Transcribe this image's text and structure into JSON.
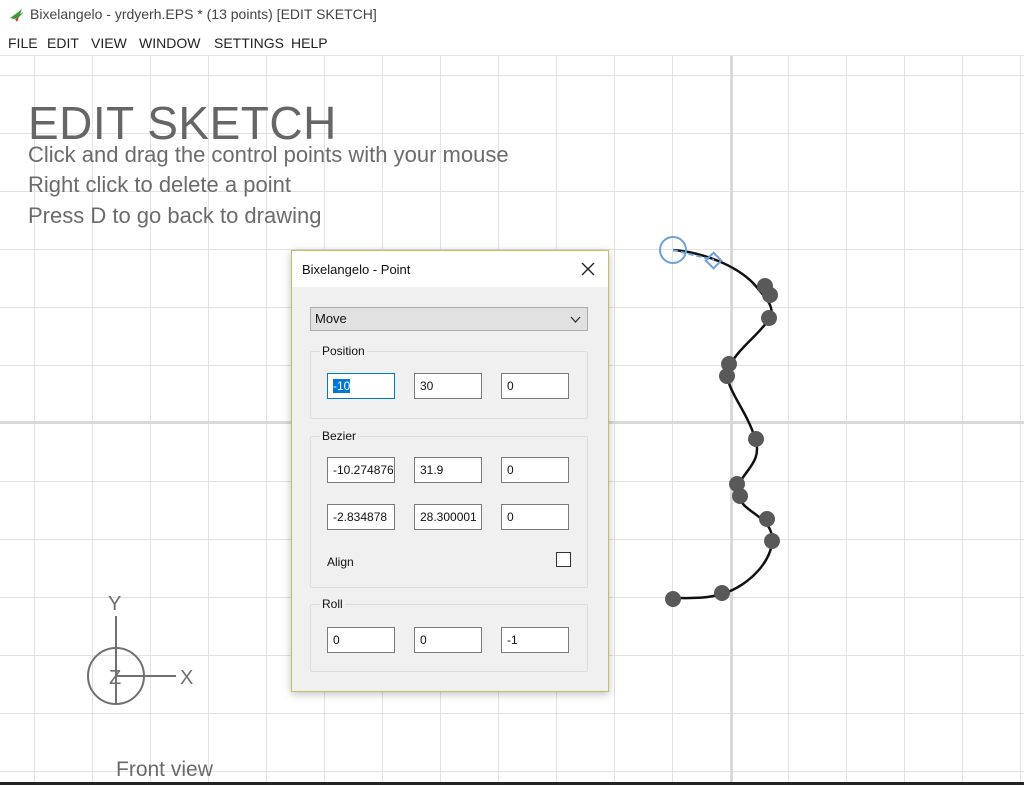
{
  "window": {
    "title": "Bixelangelo - yrdyerh.EPS * (13 points) [EDIT SKETCH]",
    "app_icon": "hummingbird-icon"
  },
  "menu": [
    "FILE",
    "EDIT",
    "VIEW",
    "WINDOW",
    "SETTINGS",
    "HELP"
  ],
  "canvas": {
    "heading": "EDIT SKETCH",
    "hints": [
      "Click and drag the control points with your mouse",
      "Right click to delete a point",
      "Press D to go back to drawing"
    ],
    "view_label": "Front view",
    "axes": {
      "y": "Y",
      "z": "Z",
      "x": "X"
    }
  },
  "dialog": {
    "title": "Bixelangelo - Point",
    "mode": "Move",
    "position": {
      "label": "Position",
      "values": [
        "-10",
        "30",
        "0"
      ]
    },
    "bezier": {
      "label": "Bezier",
      "row1": [
        "-10.274876",
        "31.9",
        "0"
      ],
      "row2": [
        "-2.834878",
        "28.300001",
        "0"
      ],
      "align_label": "Align",
      "align_checked": false
    },
    "roll": {
      "label": "Roll",
      "values": [
        "0",
        "0",
        "-1"
      ]
    }
  },
  "colors": {
    "accent": "#0078d7",
    "selected_point": "#6fa0d8",
    "control_point": "#595959",
    "curve": "#111111"
  }
}
